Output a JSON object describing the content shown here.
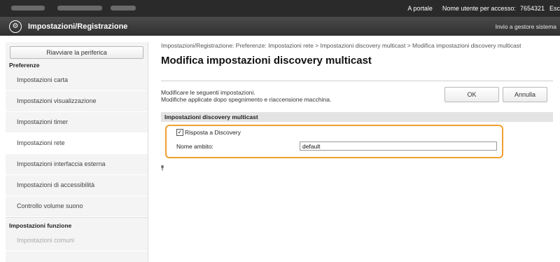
{
  "topbar": {
    "portal_link": "A portale",
    "user_label": "Nome utente per accesso:",
    "user_id": "7654321",
    "logout": "Esc"
  },
  "header": {
    "logo_icon": "settings-gear-icon",
    "title": "Impostazioni/Registrazione",
    "goto_portal": "Invio a gestore sistema"
  },
  "sidebar": {
    "restart_button": "Riavviare la periferica",
    "section1": "Preferenze",
    "items": [
      {
        "label": "Impostazioni carta"
      },
      {
        "label": "Impostazioni visualizzazione"
      },
      {
        "label": "Impostazioni timer"
      },
      {
        "label": "Impostazioni rete"
      },
      {
        "label": "Impostazioni interfaccia esterna"
      },
      {
        "label": "Impostazioni di accessibilità"
      },
      {
        "label": "Controllo volume suono"
      }
    ],
    "section2": "Impostazioni funzione",
    "items2": [
      {
        "label": "Impostazioni comuni"
      }
    ]
  },
  "main": {
    "breadcrumb": "Impostazioni/Registrazione: Preferenze: Impostazioni rete > Impostazioni discovery multicast > Modifica impostazioni discovery multicast",
    "title": "Modifica impostazioni discovery multicast",
    "desc_line1": "Modificare le seguenti impostazioni.",
    "desc_line2": "Modifiche applicate dopo spegnimento e riaccensione macchina.",
    "ok_button": "OK",
    "cancel_button": "Annulla",
    "section_title": "Impostazioni discovery multicast",
    "checkbox_label": "Risposta a Discovery",
    "checkbox_checked": true,
    "name_label": "Nome ambito:",
    "name_value": "default",
    "top_icon": "back-to-top-icon",
    "highlight_color": "#f0a030"
  }
}
